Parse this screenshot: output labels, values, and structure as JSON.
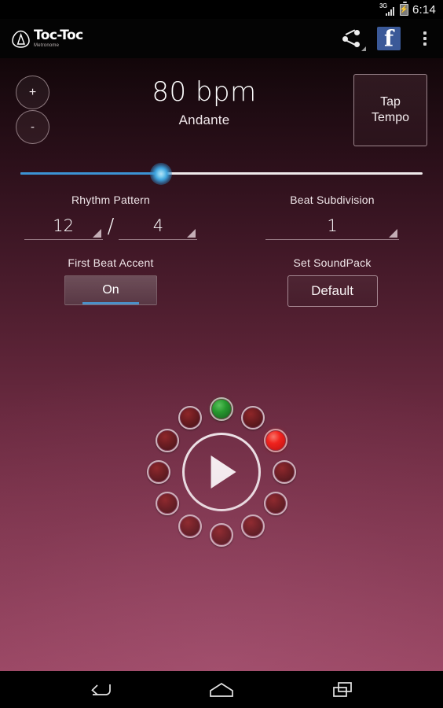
{
  "statusbar": {
    "network_label": "3G",
    "time": "6:14",
    "battery_icon": "battery-charging-icon",
    "signal_icon": "signal-bars-icon"
  },
  "actionbar": {
    "logo_title": "Toc-Toc",
    "logo_subtitle": "Metronome",
    "logo_icon": "toc-toc-logo-icon",
    "share_icon": "share-icon",
    "share_caret_icon": "dropdown-caret-icon",
    "facebook_icon": "facebook-icon",
    "facebook_glyph": "f",
    "overflow_icon": "overflow-menu-icon"
  },
  "tempo": {
    "increase_label": "+",
    "decrease_label": "-",
    "bpm": "80 bpm",
    "bpm_value": 80,
    "tempo_name": "Andante",
    "tap_tempo_label": "Tap\nTempo",
    "tap_tempo_line1": "Tap",
    "tap_tempo_line2": "Tempo"
  },
  "slider": {
    "name": "tempo-slider",
    "value": 80,
    "min": 10,
    "max": 250,
    "fill_color": "#3c93d4",
    "track_color": "#efe9ea",
    "thumb_color": "#3ea3dd",
    "percent": 35
  },
  "settings": {
    "rhythm_pattern": {
      "label": "Rhythm Pattern",
      "numerator": "12",
      "denominator": "4",
      "separator": "/"
    },
    "beat_subdivision": {
      "label": "Beat Subdivision",
      "value": "1"
    },
    "first_beat_accent": {
      "label": "First Beat Accent",
      "value": "On",
      "accent_color": "#4b90c8"
    },
    "soundpack": {
      "label": "Set SoundPack",
      "value": "Default"
    }
  },
  "beat_circle": {
    "play_icon": "play-icon",
    "total_beats": 12,
    "leds": [
      {
        "index": 1,
        "state": "first",
        "color": "#1f9c2a"
      },
      {
        "index": 2,
        "state": "off",
        "color": "#6d1a1c"
      },
      {
        "index": 3,
        "state": "active",
        "color": "#f81f16"
      },
      {
        "index": 4,
        "state": "off",
        "color": "#6d1a1c"
      },
      {
        "index": 5,
        "state": "off",
        "color": "#6d1a1c"
      },
      {
        "index": 6,
        "state": "off",
        "color": "#6d1a1c"
      },
      {
        "index": 7,
        "state": "off",
        "color": "#6d1a1c"
      },
      {
        "index": 8,
        "state": "off",
        "color": "#6d1a1c"
      },
      {
        "index": 9,
        "state": "off",
        "color": "#6d1a1c"
      },
      {
        "index": 10,
        "state": "off",
        "color": "#6d1a1c"
      },
      {
        "index": 11,
        "state": "off",
        "color": "#6d1a1c"
      },
      {
        "index": 12,
        "state": "off",
        "color": "#6d1a1c"
      }
    ]
  },
  "navbar": {
    "back_icon": "back-icon",
    "home_icon": "home-icon",
    "recents_icon": "recents-icon"
  }
}
